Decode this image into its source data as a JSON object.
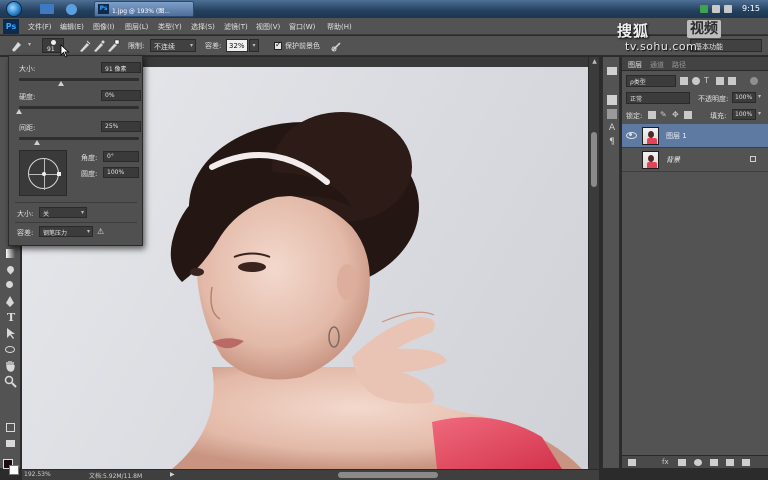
{
  "taskbar": {
    "active_task": "1.jpg @ 193% (图...",
    "clock": "9:15"
  },
  "menubar": {
    "logo": "Ps",
    "items": [
      "文件(F)",
      "编辑(E)",
      "图像(I)",
      "图层(L)",
      "类型(Y)",
      "选择(S)",
      "滤镜(T)",
      "视图(V)",
      "窗口(W)",
      "帮助(H)"
    ]
  },
  "watermark": {
    "brand": "搜狐",
    "video": "视频",
    "url": "tv.sohu.com"
  },
  "options": {
    "brush_size": "91",
    "limits_label": "限制:",
    "limits_value": "不连续",
    "tolerance_label": "容差:",
    "tolerance_value": "32%",
    "protect_label": "保护前景色",
    "protect_checked": true,
    "workspace": "基本功能"
  },
  "brush_popup": {
    "size_label": "大小:",
    "size_value": "91 像素",
    "size_fraction": 0.35,
    "hardness_label": "硬度:",
    "hardness_value": "0%",
    "hardness_fraction": 0.0,
    "spacing_label": "间距:",
    "spacing_value": "25%",
    "spacing_fraction": 0.15,
    "angle_label": "角度:",
    "angle_value": "0°",
    "roundness_label": "圆度:",
    "roundness_value": "100%",
    "size_control_label": "大小:",
    "size_control_value": "关",
    "tolerance_control_label": "容差:",
    "tolerance_control_value": "钢笔压力"
  },
  "status": {
    "zoom": "192.53%",
    "doc": "文档:5.92M/11.8M",
    "arrow": "▶"
  },
  "layers_panel": {
    "tabs": [
      "图层",
      "通道",
      "路径"
    ],
    "kind_label": "ρ类型",
    "blend_mode": "正常",
    "opacity_label": "不透明度:",
    "opacity_value": "100%",
    "lock_label": "锁定:",
    "fill_label": "填充:",
    "fill_value": "100%",
    "layers": [
      {
        "name": "图层 1",
        "visible": true,
        "selected": true
      },
      {
        "name": "背景",
        "visible": false,
        "selected": false
      }
    ]
  },
  "colors": {
    "foreground": "#1a0d0d",
    "background": "#ffffff",
    "selection": "#5e7aa3",
    "panel": "#535353"
  }
}
